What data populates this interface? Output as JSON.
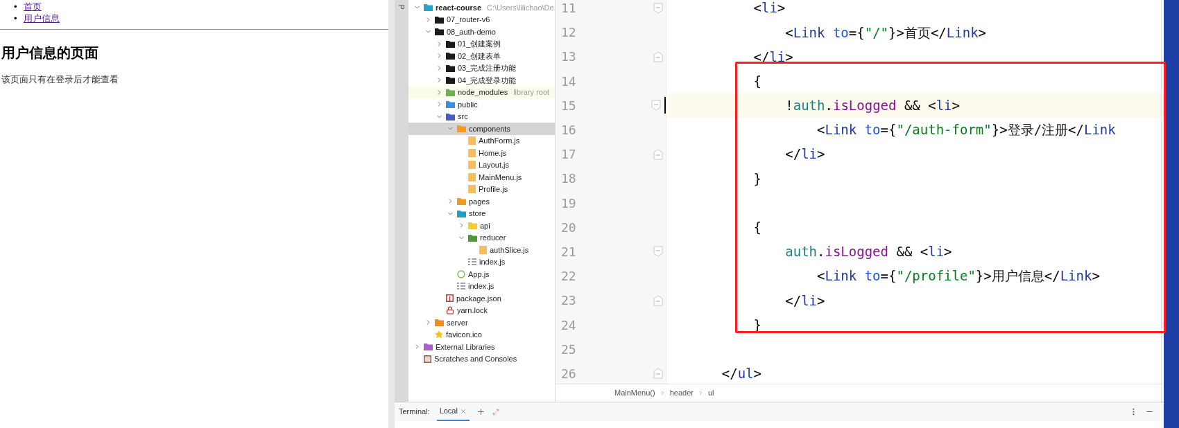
{
  "browser": {
    "nav_links": [
      {
        "bullet": "•",
        "label": "首页"
      },
      {
        "bullet": "•",
        "label": "用户信息"
      }
    ],
    "heading": "用户信息的页面",
    "paragraph": "该页面只有在登录后才能查看"
  },
  "ide": {
    "project_tab": "P",
    "tree": [
      {
        "label": "react-course",
        "hint": "C:\\Users\\lilichao\\De",
        "kind": "module-folder",
        "expanded": true,
        "selected": false,
        "children": [
          {
            "label": "07_router-v6",
            "kind": "folder",
            "expanded": false,
            "selected": false
          },
          {
            "label": "08_auth-demo",
            "kind": "folder",
            "expanded": true,
            "selected": false,
            "children": [
              {
                "label": "01_创建案例",
                "kind": "folder",
                "expanded": false,
                "selected": false
              },
              {
                "label": "02_创建表单",
                "kind": "folder",
                "expanded": false,
                "selected": false
              },
              {
                "label": "03_完成注册功能",
                "kind": "folder",
                "expanded": false,
                "selected": false
              },
              {
                "label": "04_完成登录功能",
                "kind": "folder",
                "expanded": false,
                "selected": false
              },
              {
                "label": "node_modules",
                "hint": "library root",
                "kind": "excluded-folder",
                "expanded": false,
                "selected": false
              },
              {
                "label": "public",
                "kind": "resource-folder",
                "expanded": false,
                "selected": false
              },
              {
                "label": "src",
                "kind": "source-folder",
                "expanded": true,
                "selected": false,
                "children": [
                  {
                    "label": "components",
                    "kind": "component-folder",
                    "expanded": true,
                    "selected": true,
                    "children": [
                      {
                        "label": "AuthForm.js",
                        "kind": "js",
                        "selected": false
                      },
                      {
                        "label": "Home.js",
                        "kind": "js",
                        "selected": false
                      },
                      {
                        "label": "Layout.js",
                        "kind": "js",
                        "selected": false
                      },
                      {
                        "label": "MainMenu.js",
                        "kind": "js",
                        "selected": false
                      },
                      {
                        "label": "Profile.js",
                        "kind": "js",
                        "selected": false
                      }
                    ]
                  },
                  {
                    "label": "pages",
                    "kind": "component-folder",
                    "expanded": false,
                    "selected": false
                  },
                  {
                    "label": "store",
                    "kind": "store-folder",
                    "expanded": true,
                    "selected": false,
                    "children": [
                      {
                        "label": "api",
                        "kind": "api-folder",
                        "expanded": false,
                        "selected": false
                      },
                      {
                        "label": "reducer",
                        "kind": "reducer-folder",
                        "expanded": true,
                        "selected": false,
                        "children": [
                          {
                            "label": "authSlice.js",
                            "kind": "js",
                            "selected": false
                          }
                        ]
                      },
                      {
                        "label": "index.js",
                        "kind": "index",
                        "selected": false
                      }
                    ]
                  },
                  {
                    "label": "App.js",
                    "kind": "node-js",
                    "selected": false
                  },
                  {
                    "label": "index.js",
                    "kind": "index",
                    "selected": false
                  }
                ]
              },
              {
                "label": "package.json",
                "kind": "package",
                "selected": false
              },
              {
                "label": "yarn.lock",
                "kind": "lock",
                "selected": false
              }
            ]
          },
          {
            "label": "server",
            "kind": "server-folder",
            "expanded": false,
            "selected": false
          },
          {
            "label": "favicon.ico",
            "kind": "star",
            "selected": false
          }
        ]
      },
      {
        "label": "External Libraries",
        "kind": "libraries",
        "expanded": false,
        "selected": false
      },
      {
        "label": "Scratches and Consoles",
        "kind": "scratches",
        "selected": false
      }
    ],
    "code_lines": [
      {
        "number": "11",
        "fold_start": true,
        "fold_end": false,
        "current": false,
        "tokens": [
          {
            "t": "        <",
            "kind": "punct"
          },
          {
            "t": "li",
            "kind": "tag"
          },
          {
            "t": ">",
            "kind": "punct"
          }
        ]
      },
      {
        "number": "12",
        "fold_start": false,
        "fold_end": false,
        "current": false,
        "tokens": [
          {
            "t": "            <",
            "kind": "punct"
          },
          {
            "t": "Link",
            "kind": "tag"
          },
          {
            "t": " to",
            "kind": "attr"
          },
          {
            "t": "={",
            "kind": "punct"
          },
          {
            "t": "\"/\"",
            "kind": "string"
          },
          {
            "t": "}>",
            "kind": "punct"
          },
          {
            "t": "首页",
            "kind": "text"
          },
          {
            "t": "</",
            "kind": "punct"
          },
          {
            "t": "Link",
            "kind": "tag"
          },
          {
            "t": ">",
            "kind": "punct"
          }
        ]
      },
      {
        "number": "13",
        "fold_start": false,
        "fold_end": true,
        "current": false,
        "tokens": [
          {
            "t": "        </",
            "kind": "punct"
          },
          {
            "t": "li",
            "kind": "tag"
          },
          {
            "t": ">",
            "kind": "punct"
          }
        ]
      },
      {
        "number": "14",
        "fold_start": false,
        "fold_end": false,
        "current": false,
        "tokens": [
          {
            "t": "        {",
            "kind": "punct"
          }
        ]
      },
      {
        "number": "15",
        "fold_start": true,
        "fold_end": false,
        "current": true,
        "tokens": [
          {
            "t": "            !",
            "kind": "punct"
          },
          {
            "t": "auth",
            "kind": "var"
          },
          {
            "t": ".",
            "kind": "punct"
          },
          {
            "t": "isLogged",
            "kind": "prop"
          },
          {
            "t": " && <",
            "kind": "punct"
          },
          {
            "t": "li",
            "kind": "tag"
          },
          {
            "t": ">",
            "kind": "punct"
          }
        ]
      },
      {
        "number": "16",
        "fold_start": false,
        "fold_end": false,
        "current": false,
        "tokens": [
          {
            "t": "                <",
            "kind": "punct"
          },
          {
            "t": "Link",
            "kind": "tag"
          },
          {
            "t": " to",
            "kind": "attr"
          },
          {
            "t": "={",
            "kind": "punct"
          },
          {
            "t": "\"/auth-form\"",
            "kind": "string"
          },
          {
            "t": "}>",
            "kind": "punct"
          },
          {
            "t": "登录/注册",
            "kind": "text"
          },
          {
            "t": "</",
            "kind": "punct"
          },
          {
            "t": "Link",
            "kind": "tag"
          }
        ]
      },
      {
        "number": "17",
        "fold_start": false,
        "fold_end": true,
        "current": false,
        "tokens": [
          {
            "t": "            </",
            "kind": "punct"
          },
          {
            "t": "li",
            "kind": "tag"
          },
          {
            "t": ">",
            "kind": "punct"
          }
        ]
      },
      {
        "number": "18",
        "fold_start": false,
        "fold_end": false,
        "current": false,
        "tokens": [
          {
            "t": "        }",
            "kind": "punct"
          }
        ]
      },
      {
        "number": "19",
        "fold_start": false,
        "fold_end": false,
        "current": false
      },
      {
        "number": "20",
        "fold_start": false,
        "fold_end": false,
        "current": false,
        "tokens": [
          {
            "t": "        {",
            "kind": "punct"
          }
        ]
      },
      {
        "number": "21",
        "fold_start": true,
        "fold_end": false,
        "current": false,
        "tokens": [
          {
            "t": "            auth",
            "kind": "var"
          },
          {
            "t": ".",
            "kind": "punct"
          },
          {
            "t": "isLogged",
            "kind": "prop"
          },
          {
            "t": " && <",
            "kind": "punct"
          },
          {
            "t": "li",
            "kind": "tag"
          },
          {
            "t": ">",
            "kind": "punct"
          }
        ]
      },
      {
        "number": "22",
        "fold_start": false,
        "fold_end": false,
        "current": false,
        "tokens": [
          {
            "t": "                <",
            "kind": "punct"
          },
          {
            "t": "Link",
            "kind": "tag"
          },
          {
            "t": " to",
            "kind": "attr"
          },
          {
            "t": "={",
            "kind": "punct"
          },
          {
            "t": "\"/profile\"",
            "kind": "string"
          },
          {
            "t": "}>",
            "kind": "punct"
          },
          {
            "t": "用户信息",
            "kind": "text"
          },
          {
            "t": "</",
            "kind": "punct"
          },
          {
            "t": "Link",
            "kind": "tag"
          },
          {
            "t": ">",
            "kind": "punct"
          }
        ]
      },
      {
        "number": "23",
        "fold_start": false,
        "fold_end": true,
        "current": false,
        "tokens": [
          {
            "t": "            </",
            "kind": "punct"
          },
          {
            "t": "li",
            "kind": "tag"
          },
          {
            "t": ">",
            "kind": "punct"
          }
        ]
      },
      {
        "number": "24",
        "fold_start": false,
        "fold_end": false,
        "current": false,
        "tokens": [
          {
            "t": "        }",
            "kind": "punct"
          }
        ]
      },
      {
        "number": "25",
        "fold_start": false,
        "fold_end": false,
        "current": false
      },
      {
        "number": "26",
        "fold_start": false,
        "fold_end": true,
        "current": false,
        "tokens": [
          {
            "t": "    </",
            "kind": "punct"
          },
          {
            "t": "ul",
            "kind": "tag"
          },
          {
            "t": ">",
            "kind": "punct"
          }
        ]
      }
    ],
    "breadcrumbs": [
      "MainMenu()",
      "header",
      "ul"
    ],
    "terminal": {
      "title": "Terminal:",
      "tabs": [
        {
          "label": "Local",
          "selected": true
        }
      ]
    }
  }
}
